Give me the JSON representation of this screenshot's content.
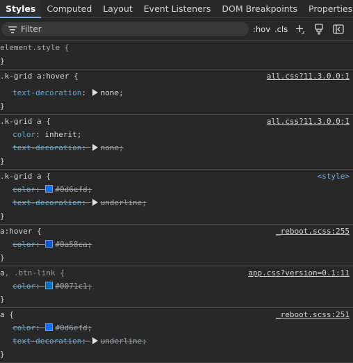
{
  "tabs": [
    "Styles",
    "Computed",
    "Layout",
    "Event Listeners",
    "DOM Breakpoints",
    "Properties"
  ],
  "toolbar": {
    "filter_placeholder": "Filter",
    "hov": ":hov",
    "cls": ".cls"
  },
  "icons": [
    "filter-icon",
    "plus-icon",
    "paint-brush-icon",
    "sidebar-toggle-icon"
  ],
  "rules": {
    "element": {
      "selector": "element.style {",
      "close": "}"
    },
    "r1": {
      "selector": ".k-grid a:hover {",
      "source": "all.css?11.3.0.0:1",
      "p1n": "text-decoration",
      "p1v": "none;",
      "close": "}"
    },
    "r2": {
      "selector": ".k-grid a {",
      "source": "all.css?11.3.0.0:1",
      "p1n": "color",
      "p1v": "inherit;",
      "p2n": "text-decoration",
      "p2v": "none;",
      "close": "}"
    },
    "r3": {
      "selector": ".k-grid a {",
      "source": "<style>",
      "p1n": "color",
      "p1v": "#0d6efd;",
      "p1c": "#0d6efd",
      "p2n": "text-decoration",
      "p2v": "underline;",
      "close": "}"
    },
    "r4": {
      "selector": "a:hover {",
      "source": "_reboot.scss:255",
      "p1n": "color",
      "p1v": "#0a58ca;",
      "p1c": "#0a58ca",
      "close": "}"
    },
    "r5": {
      "selector_a": "a",
      "selector_b": ", .btn-link {",
      "source": "app.css?version=0.1:11",
      "p1n": "color",
      "p1v": "#0071c1;",
      "p1c": "#0071c1",
      "close": "}"
    },
    "r6": {
      "selector": "a {",
      "source": "_reboot.scss:251",
      "p1n": "color",
      "p1v": "#0d6efd;",
      "p1c": "#0d6efd",
      "p2n": "text-decoration",
      "p2v": "underline;",
      "close": "}"
    }
  },
  "colors": {
    "accent": "#7cacf8",
    "property": "#5db0d7"
  }
}
